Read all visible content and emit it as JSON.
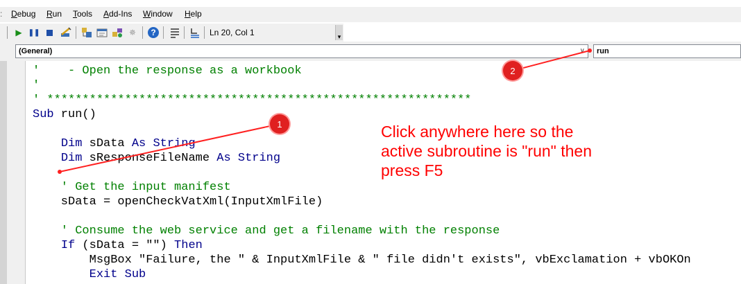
{
  "menu": {
    "items": [
      {
        "label": "Debug",
        "ul": "D",
        "rest": "ebug"
      },
      {
        "label": "Run",
        "ul": "R",
        "rest": "un"
      },
      {
        "label": "Tools",
        "ul": "T",
        "rest": "ools"
      },
      {
        "label": "Add-Ins",
        "ul": "A",
        "rest": "dd-Ins"
      },
      {
        "label": "Window",
        "ul": "W",
        "rest": "indow"
      },
      {
        "label": "Help",
        "ul": "H",
        "rest": "elp"
      }
    ]
  },
  "toolbar": {
    "cursor_position": "Ln 20, Col 1"
  },
  "combos": {
    "object": "(General)",
    "procedure": "run"
  },
  "code": {
    "lines": [
      [
        {
          "t": "'    - Open the response as a workbook",
          "c": "cm"
        }
      ],
      [
        {
          "t": "'",
          "c": "cm"
        }
      ],
      [
        {
          "t": "' ************************************************************",
          "c": "cm"
        }
      ],
      [
        {
          "t": "Sub",
          "c": "kw"
        },
        {
          "t": " run()",
          "c": "plain"
        }
      ],
      [
        {
          "t": "",
          "c": "plain"
        }
      ],
      [
        {
          "t": "    ",
          "c": "plain"
        },
        {
          "t": "Dim",
          "c": "kw"
        },
        {
          "t": " sData ",
          "c": "plain"
        },
        {
          "t": "As String",
          "c": "kw"
        }
      ],
      [
        {
          "t": "    ",
          "c": "plain"
        },
        {
          "t": "Dim",
          "c": "kw"
        },
        {
          "t": " sResponseFileName ",
          "c": "plain"
        },
        {
          "t": "As String",
          "c": "kw"
        }
      ],
      [
        {
          "t": "",
          "c": "plain"
        }
      ],
      [
        {
          "t": "    ' Get the input manifest",
          "c": "cm"
        }
      ],
      [
        {
          "t": "    sData = openCheckVatXml(InputXmlFile)",
          "c": "plain"
        }
      ],
      [
        {
          "t": "",
          "c": "plain"
        }
      ],
      [
        {
          "t": "    ' Consume the web service and get a filename with the response",
          "c": "cm"
        }
      ],
      [
        {
          "t": "    ",
          "c": "plain"
        },
        {
          "t": "If",
          "c": "kw"
        },
        {
          "t": " (sData = \"\") ",
          "c": "plain"
        },
        {
          "t": "Then",
          "c": "kw"
        }
      ],
      [
        {
          "t": "        MsgBox \"Failure, the \" & InputXmlFile & \" file didn't exists\", vbExclamation + vbOKOn",
          "c": "plain"
        }
      ],
      [
        {
          "t": "        ",
          "c": "plain"
        },
        {
          "t": "Exit Sub",
          "c": "kw"
        }
      ]
    ]
  },
  "annotation": {
    "text": "Click anywhere here so the\nactive subroutine is \"run\" then\npress F5",
    "badge1": "1",
    "badge2": "2",
    "color": "#ff0000"
  }
}
